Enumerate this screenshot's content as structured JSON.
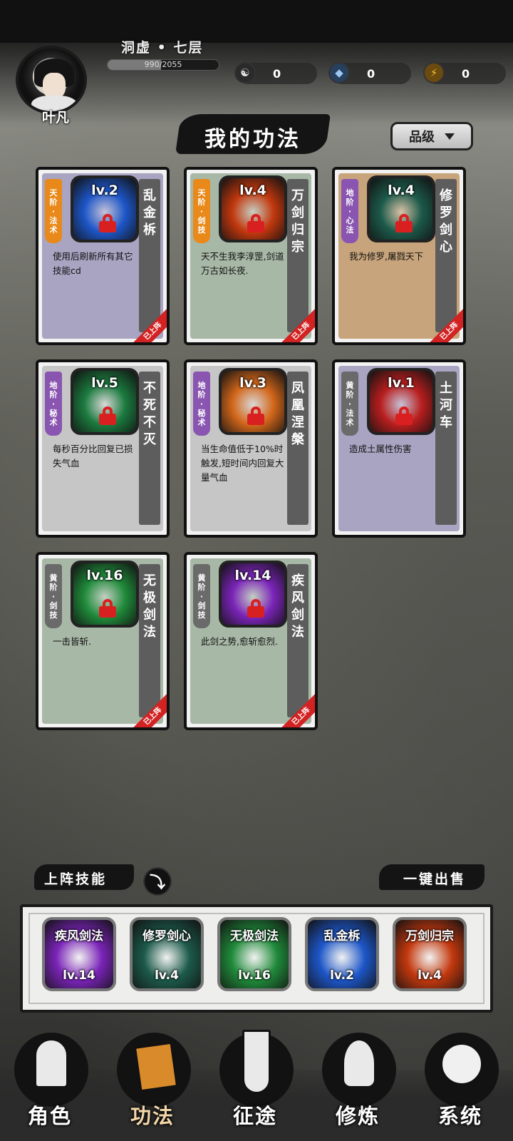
{
  "player": {
    "name": "叶凡",
    "realm": "洞虚 • 七层",
    "exp_text": "990/2055",
    "exp_fraction": 0.4818
  },
  "resources": [
    {
      "icon": "yin-yang-icon",
      "glyph": "☯",
      "value": "0",
      "color": "#e0e0e0"
    },
    {
      "icon": "crystal-icon",
      "glyph": "◆",
      "value": "0",
      "color": "#6fa8dc"
    },
    {
      "icon": "lightning-icon",
      "glyph": "⚡",
      "value": "0",
      "color": "#e8b020"
    }
  ],
  "page_title": "我的功法",
  "sort_button": "品级",
  "skills": [
    {
      "tier": "天阶 • 法术",
      "level": "lv.2",
      "name": "乱金柝",
      "desc": "使用后刷新所有其它技能cd",
      "equipped": "已上阵",
      "tag_color": "#e8891a",
      "card_color": "#a9a4c2",
      "icon_color": "#1d56c8"
    },
    {
      "tier": "天阶 • 剑技",
      "level": "lv.4",
      "name": "万剑归宗",
      "desc": "天不生我李淳罡,剑道万古如长夜.",
      "equipped": "已上阵",
      "tag_color": "#e8891a",
      "card_color": "#a8b8a6",
      "icon_color": "#c2380e"
    },
    {
      "tier": "地阶 • 心法",
      "level": "lv.4",
      "name": "修罗剑心",
      "desc": "我为修罗,屠戮天下",
      "equipped": "已上阵",
      "tag_color": "#8a55b0",
      "card_color": "#c7a47b",
      "icon_color": "#1c5a4a"
    },
    {
      "tier": "地阶 • 秘术",
      "level": "lv.5",
      "name": "不死不灭",
      "desc": "每秒百分比回复已损失气血",
      "equipped": "",
      "tag_color": "#8a55b0",
      "card_color": "#c6c6c6",
      "icon_color": "#1b7a3e"
    },
    {
      "tier": "地阶 • 秘术",
      "level": "lv.3",
      "name": "凤凰涅槃",
      "desc": "当生命值低于10%时触发,短时间内回复大量气血",
      "equipped": "",
      "tag_color": "#8a55b0",
      "card_color": "#c6c6c6",
      "icon_color": "#d2661a"
    },
    {
      "tier": "黄阶 • 法术",
      "level": "lv.1",
      "name": "土河车",
      "desc": "造成土属性伤害",
      "equipped": "",
      "tag_color": "#6a6a6a",
      "card_color": "#a9a4c2",
      "icon_color": "#b81e1e"
    },
    {
      "tier": "黄阶 • 剑技",
      "level": "lv.16",
      "name": "无极剑法",
      "desc": "一击皆斩.",
      "equipped": "已上阵",
      "tag_color": "#6a6a6a",
      "card_color": "#a8b8a6",
      "icon_color": "#1f8a3a"
    },
    {
      "tier": "黄阶 • 剑技",
      "level": "lv.14",
      "name": "疾风剑法",
      "desc": "此剑之势,愈斩愈烈.",
      "equipped": "已上阵",
      "tag_color": "#6a6a6a",
      "card_color": "#a8b8a6",
      "icon_color": "#7a24b8"
    }
  ],
  "equipped_section_label": "上阵技能",
  "sell_all_label": "一键出售",
  "equipped_slots": [
    {
      "name": "疾风剑法",
      "level": "lv.14",
      "color": "#7a24b8"
    },
    {
      "name": "修罗剑心",
      "level": "lv.4",
      "color": "#1c5a4a"
    },
    {
      "name": "无极剑法",
      "level": "lv.16",
      "color": "#1f8a3a"
    },
    {
      "name": "乱金柝",
      "level": "lv.2",
      "color": "#1d56c8"
    },
    {
      "name": "万剑归宗",
      "level": "lv.4",
      "color": "#c2380e"
    }
  ],
  "nav": [
    {
      "label": "角色",
      "icon": "hooded-figure-icon"
    },
    {
      "label": "功法",
      "icon": "books-icon"
    },
    {
      "label": "征途",
      "icon": "sword-emblem-icon"
    },
    {
      "label": "修炼",
      "icon": "meditating-figure-icon"
    },
    {
      "label": "系统",
      "icon": "girl-avatar-icon"
    }
  ]
}
